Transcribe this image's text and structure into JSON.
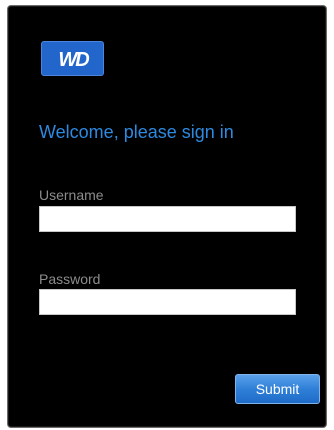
{
  "brand": {
    "logo_icon": "wd-logo-icon",
    "logo_text": "WD",
    "color": "#2266cc"
  },
  "welcome_text": "Welcome, please sign in",
  "form": {
    "username_label": "Username",
    "username_value": "",
    "password_label": "Password",
    "password_value": "",
    "submit_label": "Submit"
  },
  "colors": {
    "panel_background": "#000000",
    "accent": "#2e89e0",
    "label": "#8c8c8c"
  }
}
